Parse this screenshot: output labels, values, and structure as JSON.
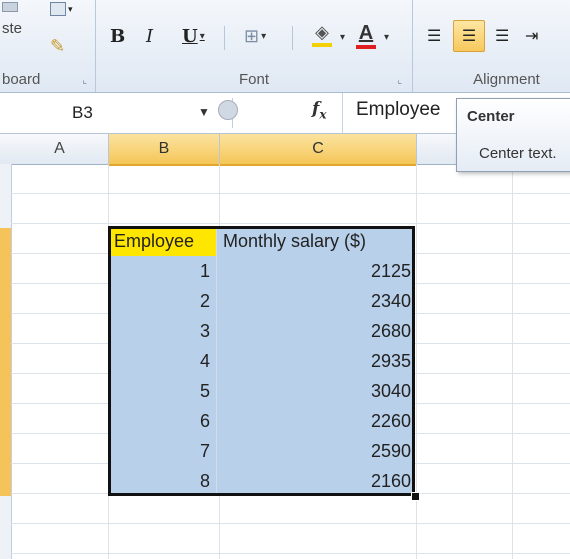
{
  "ribbon": {
    "clipboard": {
      "paste_label": "ste",
      "group_label": "board"
    },
    "font": {
      "bold": "B",
      "italic": "I",
      "underline": "U",
      "group_label": "Font",
      "font_color_letter": "A",
      "font_color": "#e02020",
      "fill_color": "#f5d000"
    },
    "alignment": {
      "group_label": "Alignment"
    }
  },
  "formula_bar": {
    "name_box": "B3",
    "fx": "fx",
    "content": "Employee"
  },
  "tooltip": {
    "title": "Center",
    "description": "Center text."
  },
  "columns": [
    "A",
    "B",
    "C"
  ],
  "table": {
    "headers": [
      "Employee",
      "Monthly salary ($)"
    ],
    "rows": [
      [
        "1",
        "2125"
      ],
      [
        "2",
        "2340"
      ],
      [
        "3",
        "2680"
      ],
      [
        "4",
        "2935"
      ],
      [
        "5",
        "3040"
      ],
      [
        "6",
        "2260"
      ],
      [
        "7",
        "2590"
      ],
      [
        "8",
        "2160"
      ]
    ]
  }
}
